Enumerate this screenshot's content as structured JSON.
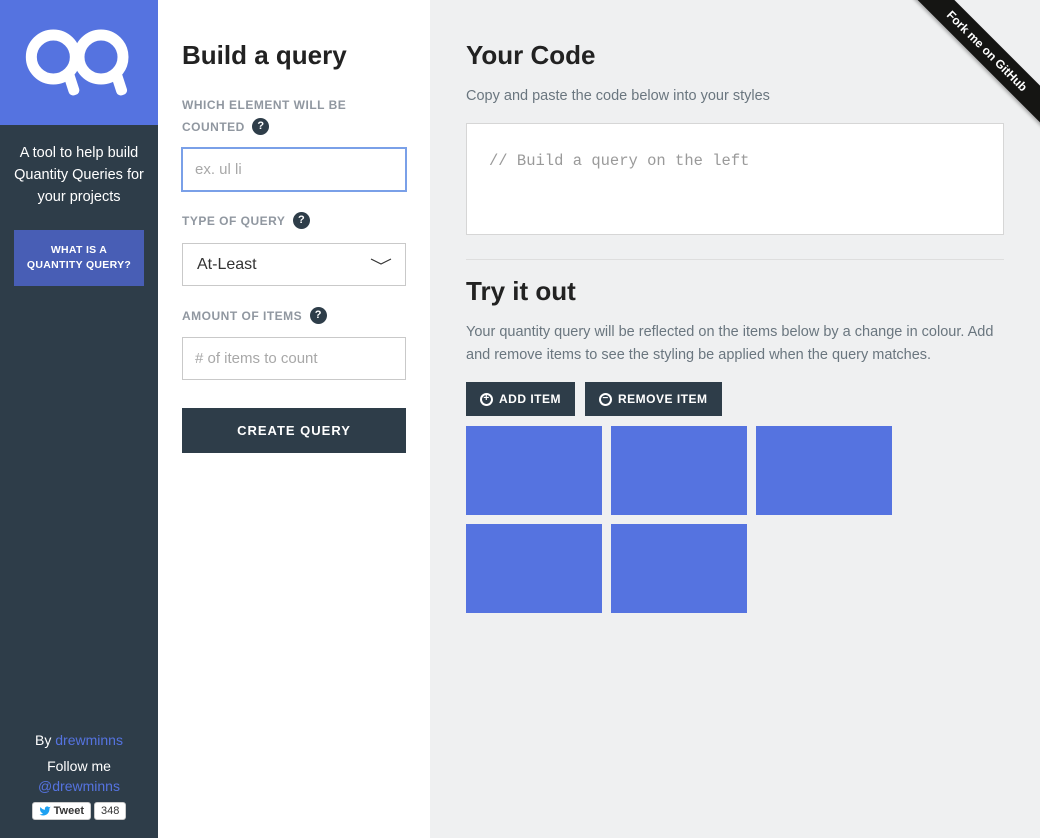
{
  "sidebar": {
    "description": "A tool to help build Quantity Queries for your projects",
    "what_button": "WHAT IS A QUANTITY QUERY?",
    "by_prefix": "By ",
    "author": "drewminns",
    "follow_label": "Follow me",
    "twitter_handle": "@drewminns",
    "tweet_label": "Tweet",
    "tweet_count": "348"
  },
  "form": {
    "title": "Build a query",
    "element_label": "WHICH ELEMENT WILL BE COUNTED",
    "element_placeholder": "ex. ul li",
    "element_value": "",
    "type_label": "TYPE OF QUERY",
    "type_selected": "At-Least",
    "amount_label": "AMOUNT OF ITEMS",
    "amount_placeholder": "# of items to count",
    "amount_value": "",
    "help_symbol": "?",
    "submit_label": "CREATE QUERY"
  },
  "code": {
    "title": "Your Code",
    "subtext": "Copy and paste the code below into your styles",
    "content": "// Build a query on the left"
  },
  "tryout": {
    "title": "Try it out",
    "subtext": "Your quantity query will be reflected on the items below by a change in colour. Add and remove items to see the styling be applied when the query matches.",
    "add_label": "ADD ITEM",
    "remove_label": "REMOVE ITEM",
    "item_count": 5
  },
  "ribbon": {
    "label": "Fork me on GitHub"
  },
  "colors": {
    "brand": "#5573e0",
    "dark": "#2e3d49"
  }
}
